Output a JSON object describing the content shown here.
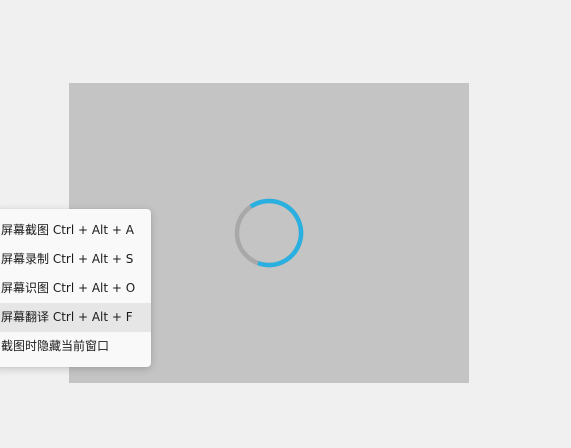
{
  "menu": {
    "items": [
      {
        "label": "屏幕截图 Ctrl + Alt + A",
        "highlighted": false
      },
      {
        "label": "屏幕录制 Ctrl + Alt + S",
        "highlighted": false
      },
      {
        "label": "屏幕识图 Ctrl + Alt + O",
        "highlighted": false
      },
      {
        "label": "屏幕翻译 Ctrl + Alt + F",
        "highlighted": true
      },
      {
        "label": "截图时隐藏当前窗口",
        "highlighted": false
      }
    ]
  },
  "spinner": {
    "icon": "loading-spinner-icon",
    "progress": 0.65,
    "accent_color": "#29b0e0",
    "track_color": "#a8a8a8"
  },
  "colors": {
    "background": "#f0f0f0",
    "preview": "#c4c4c4",
    "menu_background": "#f9f9f9",
    "menu_highlight": "#e6e6e6"
  }
}
